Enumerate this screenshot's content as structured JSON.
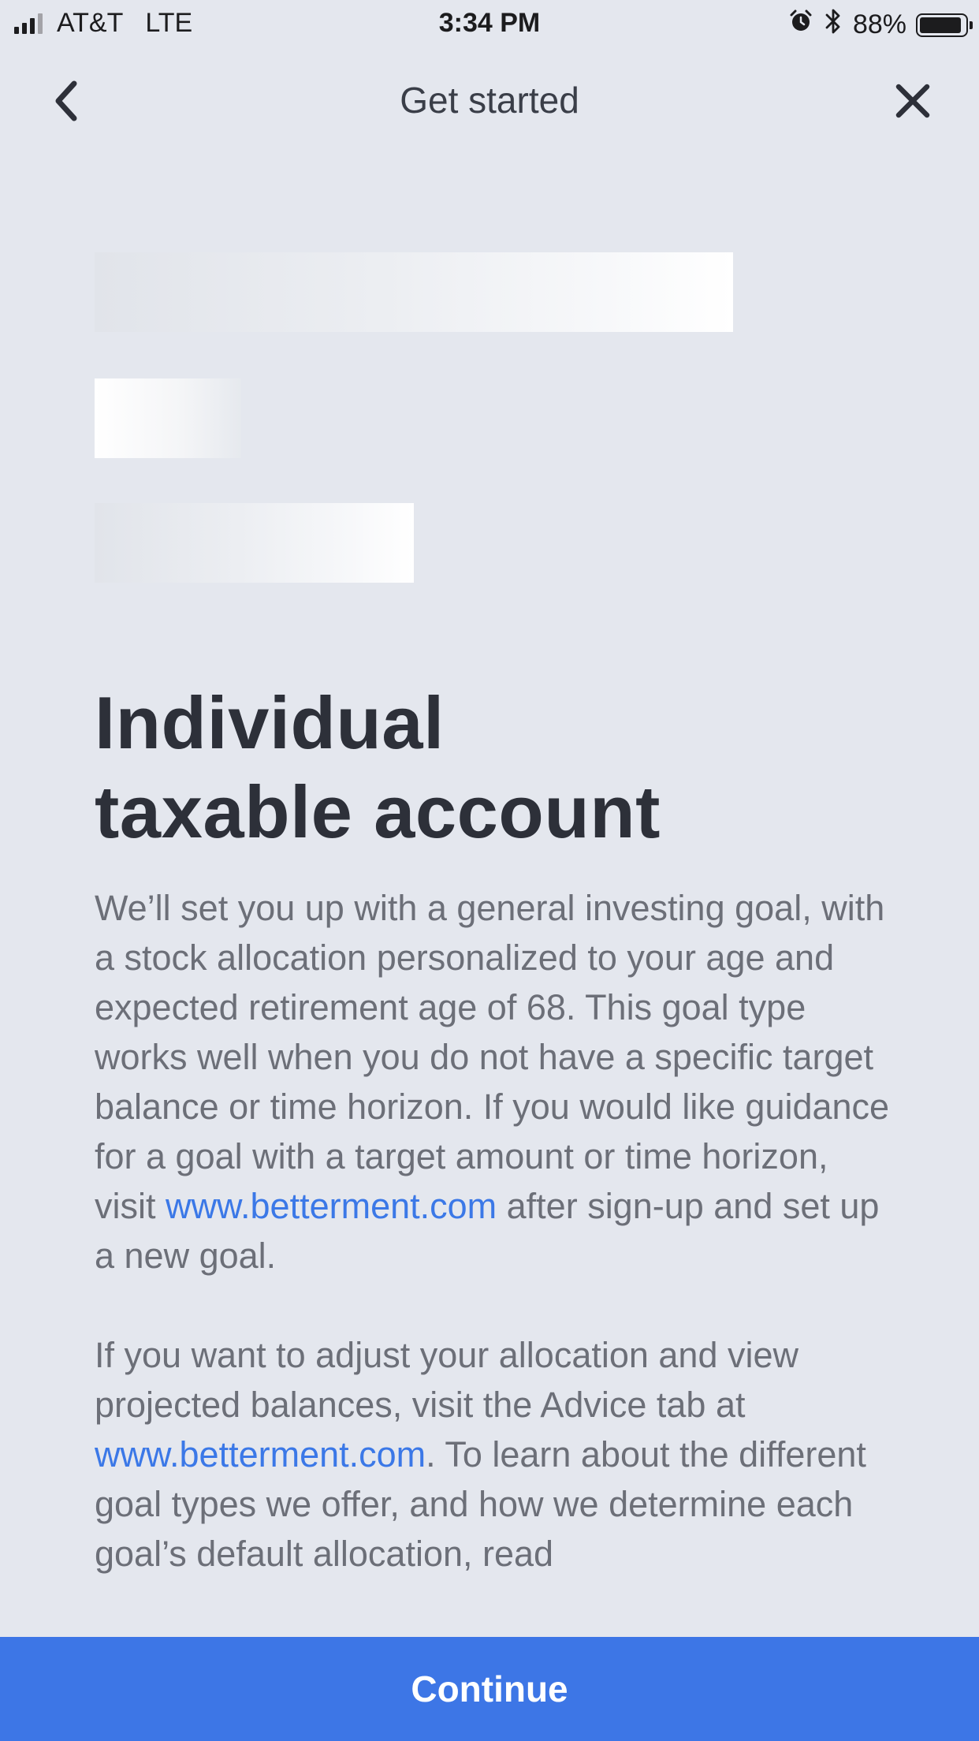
{
  "status_bar": {
    "carrier": "AT&T",
    "network": "LTE",
    "time": "3:34 PM",
    "battery": "88%",
    "icons": [
      "signal-icon",
      "alarm-icon",
      "bluetooth-icon",
      "battery-icon"
    ]
  },
  "nav": {
    "title": "Get started",
    "back_icon": "chevron-left-icon",
    "close_icon": "close-icon"
  },
  "content": {
    "heading_line1": "Individual",
    "heading_line2": "taxable account",
    "para1_before_link": "We’ll set you up with a general investing goal, with a stock allocation personalized to your age and expected retirement age of 68. This goal type works well when you do not have a specific target balance or time horizon. If you would like guidance for a goal with a target amount or time horizon, visit ",
    "para1_link": "www.betterment.com",
    "para1_after_link": " after sign-up and set up a new goal.",
    "para2_before_link": "If you want to adjust your allocation and view projected balances, visit the Advice tab at ",
    "para2_link": "www.betterment.com",
    "para2_after_link": ". To learn about the different goal types we offer, and how we determine each goal’s default allocation, read"
  },
  "footer": {
    "continue_label": "Continue"
  },
  "colors": {
    "background": "#e4e7ee",
    "heading": "#2d3039",
    "body_text": "#6c6f78",
    "link": "#3b78e7",
    "button": "#3d76e6"
  }
}
